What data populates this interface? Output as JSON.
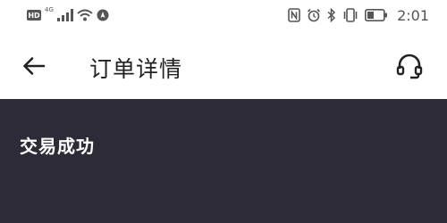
{
  "status_bar": {
    "hd_label": "HD",
    "network_label": "4G",
    "time": "2:01",
    "icons": [
      "hd-icon",
      "signal-icon",
      "wifi-icon",
      "location-icon",
      "nfc-icon",
      "alarm-icon",
      "bluetooth-icon",
      "vibrate-icon",
      "battery-icon"
    ]
  },
  "app_bar": {
    "title": "订单详情",
    "back_icon": "arrow-left-icon",
    "support_icon": "headset-icon"
  },
  "order": {
    "status": "交易成功",
    "header_color": "#2d2c36"
  }
}
